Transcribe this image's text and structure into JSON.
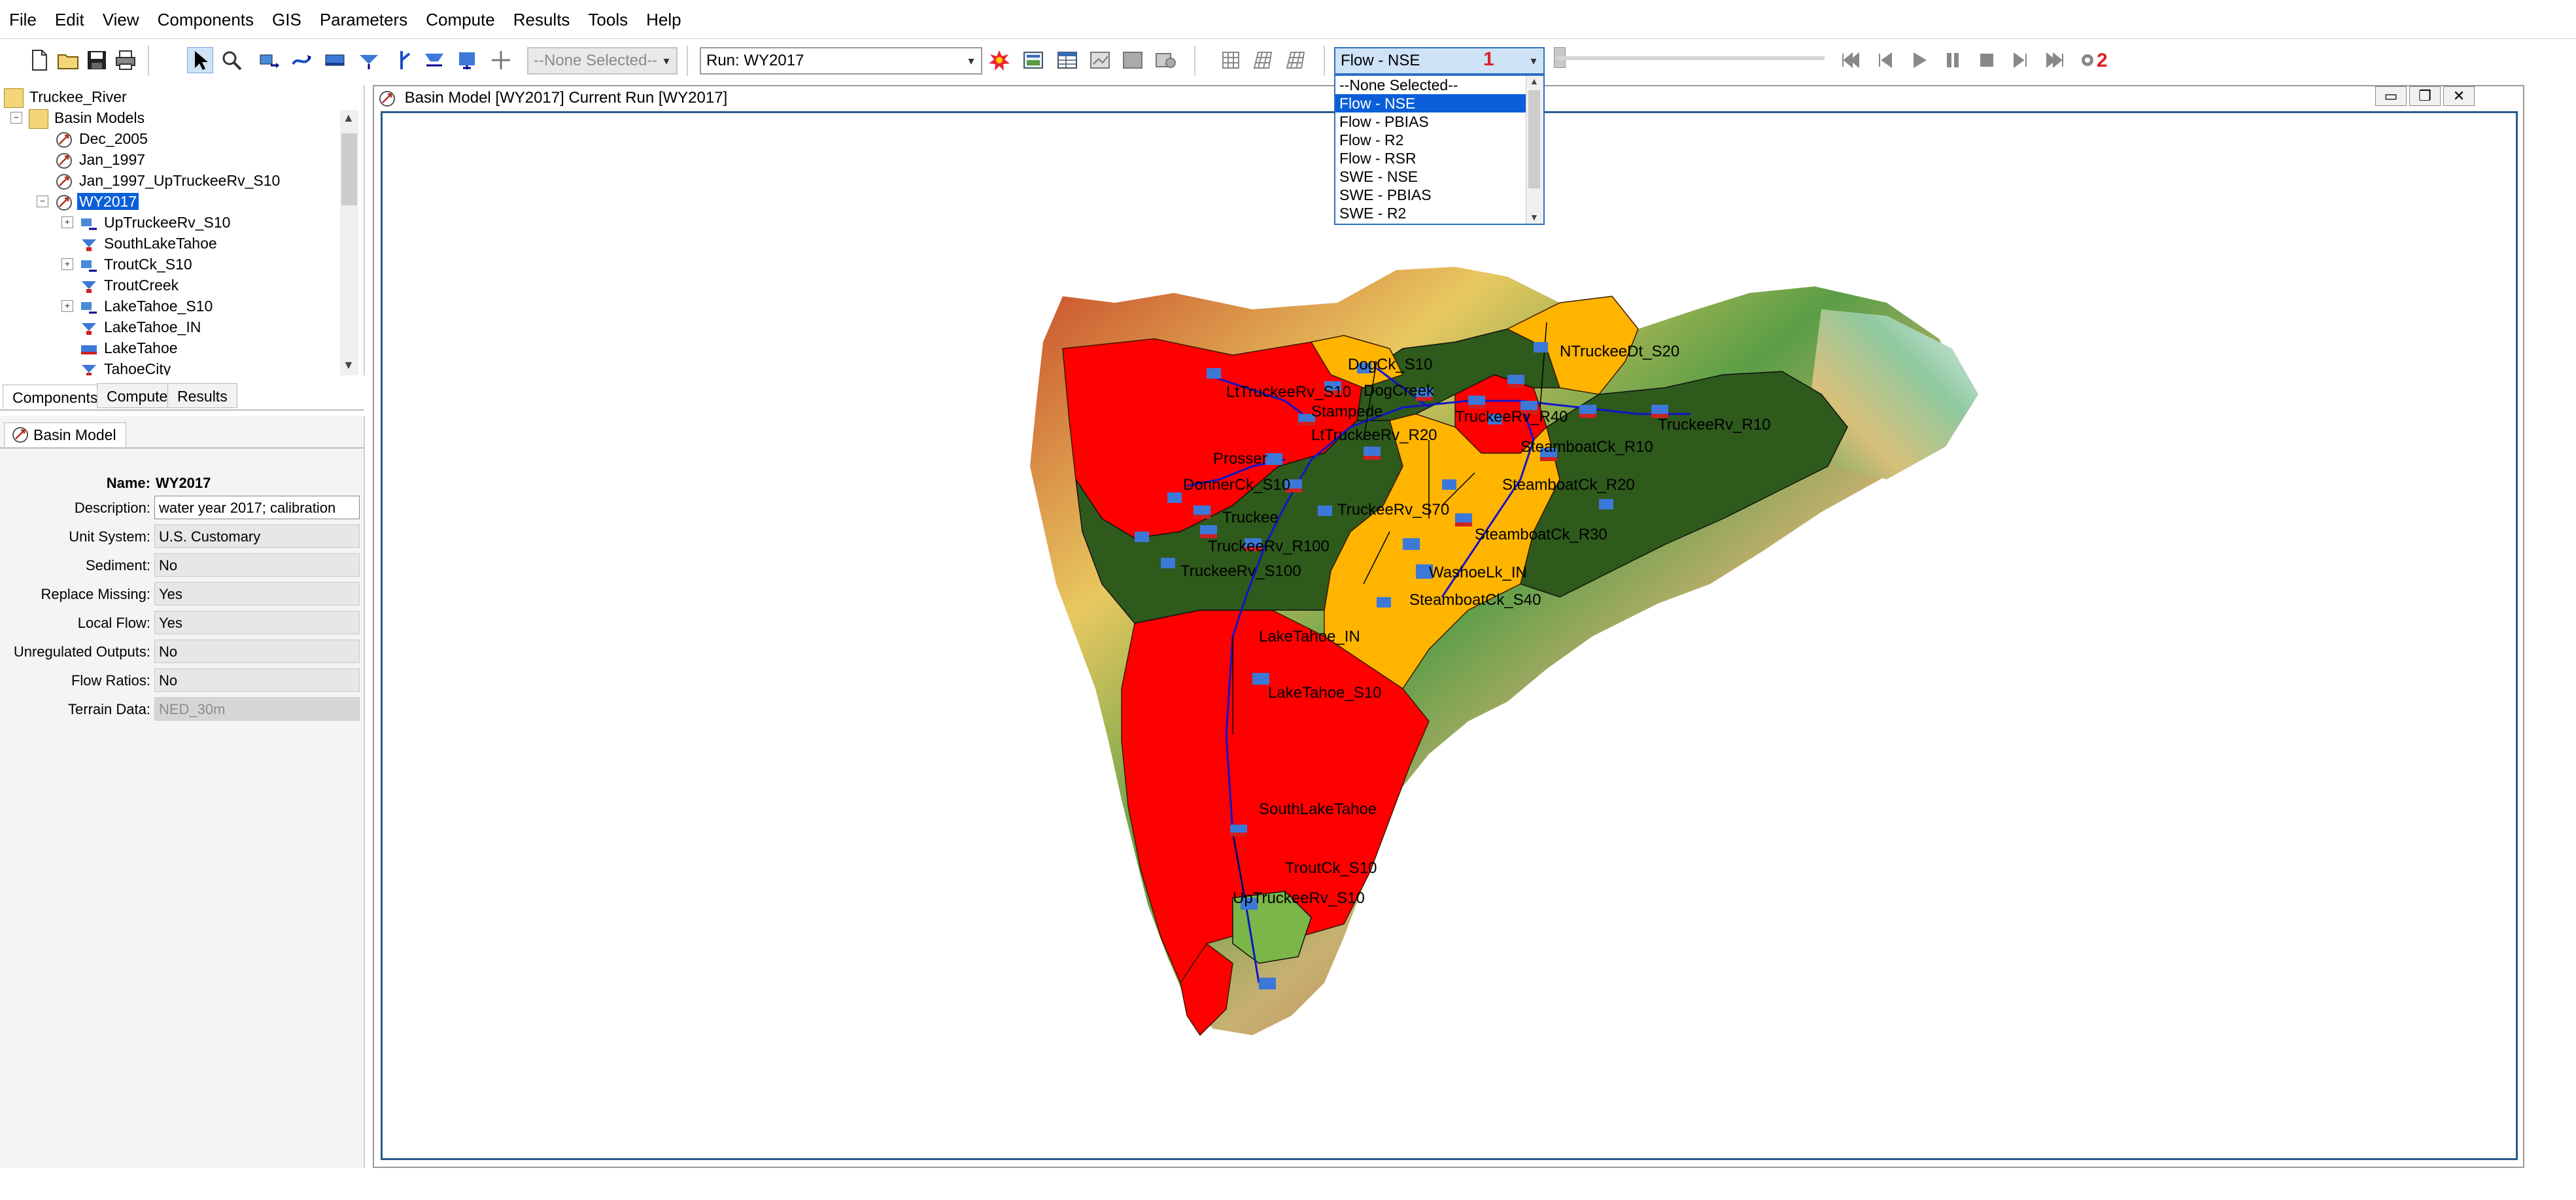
{
  "menu": [
    "File",
    "Edit",
    "View",
    "Components",
    "GIS",
    "Parameters",
    "Compute",
    "Results",
    "Tools",
    "Help"
  ],
  "toolbar": {
    "element_selector": "--None Selected--",
    "run_selector": "Run: WY2017",
    "metric_selector": "Flow - NSE",
    "badge1": "1",
    "badge2": "2"
  },
  "metric_dropdown": {
    "options": [
      "--None Selected--",
      "Flow - NSE",
      "Flow - PBIAS",
      "Flow - R2",
      "Flow - RSR",
      "SWE - NSE",
      "SWE - PBIAS",
      "SWE - R2"
    ],
    "selected": "Flow - NSE"
  },
  "tree": {
    "root": "Truckee_River",
    "basin_models_label": "Basin Models",
    "models": [
      "Dec_2005",
      "Jan_1997",
      "Jan_1997_UpTruckeeRv_S10"
    ],
    "selected_model": "WY2017",
    "elements": [
      "UpTruckeeRv_S10",
      "SouthLakeTahoe",
      "TroutCk_S10",
      "TroutCreek",
      "LakeTahoe_S10",
      "LakeTahoe_IN",
      "LakeTahoe",
      "TahoeCity"
    ]
  },
  "tabs": [
    "Components",
    "Compute",
    "Results"
  ],
  "panel_tab": "Basin Model",
  "properties": {
    "name_label": "Name:",
    "name_value": "WY2017",
    "rows": [
      {
        "label": "Description:",
        "value": "water year 2017; calibration"
      },
      {
        "label": "Unit System:",
        "value": "U.S. Customary"
      },
      {
        "label": "Sediment:",
        "value": "No"
      },
      {
        "label": "Replace Missing:",
        "value": "Yes"
      },
      {
        "label": "Local Flow:",
        "value": "Yes"
      },
      {
        "label": "Unregulated Outputs:",
        "value": "No"
      },
      {
        "label": "Flow Ratios:",
        "value": "No"
      },
      {
        "label": "Terrain Data:",
        "value": "NED_30m"
      }
    ]
  },
  "main_window": {
    "title": "Basin Model [WY2017] Current Run [WY2017]"
  },
  "map": {
    "colors": {
      "red": "#ff0000",
      "green": "#2e5a1c",
      "orange": "#ffb400",
      "lightgreen": "#7ab648",
      "reach": "#1414c8"
    },
    "labels": {
      "dogck_s10": "DogCk_S10",
      "ntruckee": "NTruckeeDt_S20",
      "ltruckee": "LtTruckeeRv_S10",
      "dogcreek": "DogCreek",
      "stampede": "Stampede",
      "truckee_r40": "TruckeeRv_R40",
      "lttruckee_r20": "LtTruckeeRv_R20",
      "steamboat_r10": "SteamboatCk_R10",
      "truckee_r10": "TruckeeRv_R10",
      "prosser": "Prosser",
      "donner": "DonnerCk_S10",
      "steamboat_r20": "SteamboatCk_R20",
      "truckee_s70": "TruckeeRv_S70",
      "truckee": "Truckee",
      "steamboat_r30": "SteamboatCk_R30",
      "truckee_r100": "TruckeeRv_R100",
      "washoe": "WashoeLk_IN",
      "truckee_s100": "TruckeeRv_S100",
      "steamboat_s40": "SteamboatCk_S40",
      "laketahoe_in": "LakeTahoe_IN",
      "laketahoe_s10": "LakeTahoe_S10",
      "southlaketahoe": "SouthLakeTahoe",
      "troutck_s10": "TroutCk_S10",
      "uptruckee": "UpTruckeeRv_S10"
    }
  }
}
